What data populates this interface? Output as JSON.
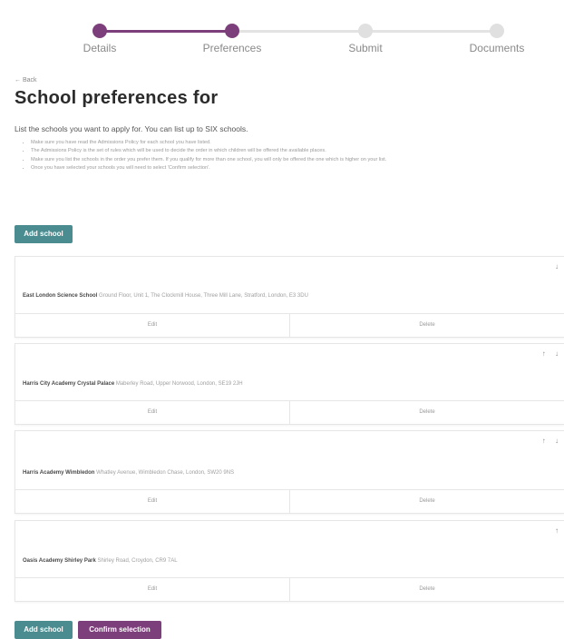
{
  "stepper": {
    "steps": [
      {
        "label": "Details",
        "state": "complete"
      },
      {
        "label": "Preferences",
        "state": "current"
      },
      {
        "label": "Submit",
        "state": "pending"
      },
      {
        "label": "Documents",
        "state": "pending"
      }
    ],
    "active_color": "#7d3f7b",
    "inactive_color": "#e0e0e0"
  },
  "back_link": "← Back",
  "title": "School preferences for",
  "intro": "List the schools you want to apply for. You can list up to SIX schools.",
  "bullets": [
    "Make sure you have read the Admissions Policy for each school you have listed.",
    "The Admissions Policy is the set of rules which will be used to decide the order in which children will be offered the available places.",
    "Make sure you list the schools in the order you prefer them. If you qualify for more than one school, you will only be offered the one which is higher on your list.",
    "Once you have selected your schools you will need to select 'Confirm selection'."
  ],
  "add_school_label": "Add school",
  "confirm_label": "Confirm selection",
  "schools": [
    {
      "name": "East London Science School",
      "address": "Ground Floor, Unit 1, The Clockmill House, Three Mill Lane, Stratford, London, E3 3DU",
      "arrows": [
        "↓"
      ],
      "edit_label": "Edit",
      "delete_label": "Delete"
    },
    {
      "name": "Harris City Academy Crystal Palace",
      "address": "Maberley Road, Upper Norwood, London, SE19 2JH",
      "arrows": [
        "↑",
        "↓"
      ],
      "edit_label": "Edit",
      "delete_label": "Delete"
    },
    {
      "name": "Harris Academy Wimbledon",
      "address": "Whatley Avenue, Wimbledon Chase, London, SW20 9NS",
      "arrows": [
        "↑",
        "↓"
      ],
      "edit_label": "Edit",
      "delete_label": "Delete"
    },
    {
      "name": "Oasis Academy Shirley Park",
      "address": "Shirley Road, Croydon, CR9 7AL",
      "arrows": [
        "↑"
      ],
      "edit_label": "Edit",
      "delete_label": "Delete"
    }
  ],
  "colors": {
    "teal_button": "#4a8c8f",
    "purple_button": "#7d3f7b"
  }
}
